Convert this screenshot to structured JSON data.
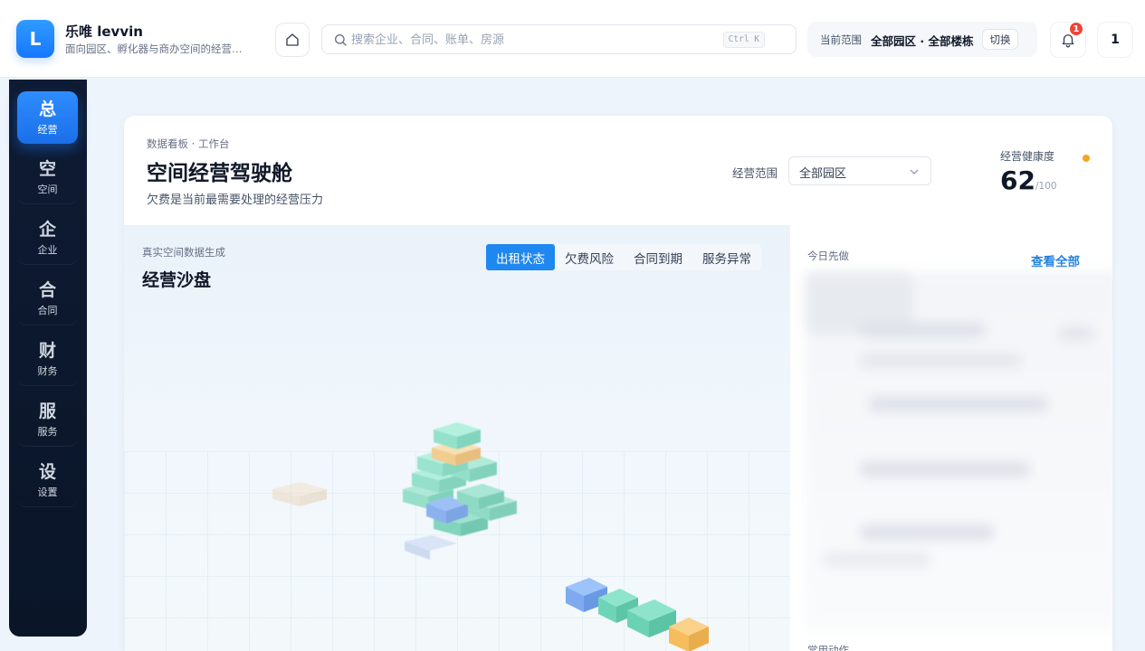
{
  "header": {
    "logo_letter": "L",
    "brand_name": "乐唯 levvin",
    "brand_sub": "面向园区、孵化器与商办空间的经营…",
    "search": {
      "placeholder": "搜索企业、合同、账单、房源",
      "shortcut": "Ctrl K"
    },
    "scope": {
      "label": "当前范围",
      "value": "全部园区 · 全部楼栋",
      "switch_label": "切换"
    },
    "notifications": {
      "count": "1"
    },
    "avatar_text": "1"
  },
  "sidebar": {
    "items": [
      {
        "glyph": "总",
        "label": "经营",
        "active": true
      },
      {
        "glyph": "空",
        "label": "空间"
      },
      {
        "glyph": "企",
        "label": "企业"
      },
      {
        "glyph": "合",
        "label": "合同"
      },
      {
        "glyph": "财",
        "label": "财务"
      },
      {
        "glyph": "服",
        "label": "服务"
      },
      {
        "glyph": "设",
        "label": "设置"
      }
    ]
  },
  "main": {
    "breadcrumb": "数据看板 · 工作台",
    "title": "空间经营驾驶舱",
    "subtitle": "欠费是当前最需要处理的经营压力",
    "range_label": "经营范围",
    "range_value": "全部园区",
    "health": {
      "label": "经营健康度",
      "score": "62",
      "max": "/100"
    }
  },
  "sand_table": {
    "note": "真实空间数据生成",
    "title": "经营沙盘",
    "tabs": [
      {
        "label": "出租状态",
        "active": true
      },
      {
        "label": "欠费风险"
      },
      {
        "label": "合同到期"
      },
      {
        "label": "服务异常"
      }
    ]
  },
  "todo": {
    "label": "今日先做",
    "see_all": "查看全部",
    "common_label": "常用动作"
  },
  "colors": {
    "accent": "#1f87f0",
    "sidebar_bg": "#0e1b33",
    "block_rented": "#6fd3b6",
    "block_expiring": "#f5c16c",
    "block_vacant": "#7fb1f4",
    "health_dot": "#f5a623"
  }
}
